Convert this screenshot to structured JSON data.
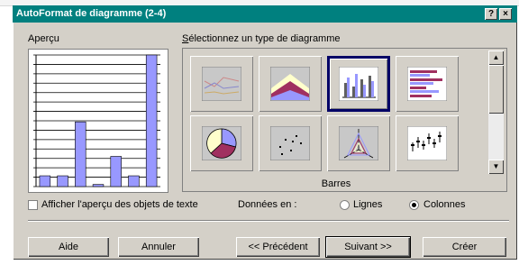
{
  "window": {
    "title": "AutoFormat de diagramme (2-4)",
    "help_glyph": "?",
    "close_glyph": "×"
  },
  "preview": {
    "label": "Aperçu",
    "bar_fill": "#9898ff",
    "values": [
      1,
      1,
      6,
      0.2,
      2.8,
      1,
      12.2
    ]
  },
  "gallery": {
    "label": "Sélectionnez un type de diagramme",
    "selected": "Barres",
    "scroll_up_glyph": "▲",
    "scroll_down_glyph": "▼",
    "tiles": [
      {
        "icon": "line-chart-icon",
        "name": "tile-lines"
      },
      {
        "icon": "area-chart-icon",
        "name": "tile-area"
      },
      {
        "icon": "bar-chart-icon",
        "name": "tile-bars",
        "selected": true
      },
      {
        "icon": "horizontal-bar-chart-icon",
        "name": "tile-horizontal-bars"
      },
      {
        "icon": "pie-chart-icon",
        "name": "tile-pie"
      },
      {
        "icon": "scatter-chart-icon",
        "name": "tile-scatter"
      },
      {
        "icon": "radar-chart-icon",
        "name": "tile-radar"
      },
      {
        "icon": "stock-chart-icon",
        "name": "tile-stock"
      }
    ]
  },
  "options": {
    "show_text_preview": "Afficher l'aperçu des objets de texte",
    "data_in_label": "Données en :",
    "rows": "Lignes",
    "columns": "Colonnes",
    "selected_series": "Colonnes"
  },
  "buttons": {
    "help": "Aide",
    "cancel": "Annuler",
    "previous": "<< Précédent",
    "next": "Suivant >>",
    "create": "Créer"
  },
  "colors": {
    "titlebar": "#00807f",
    "selection": "#000066"
  }
}
